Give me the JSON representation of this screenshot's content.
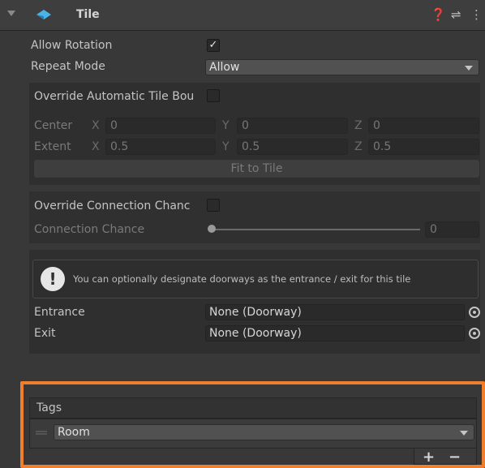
{
  "component": {
    "title": "Tile"
  },
  "fields": {
    "allow_rotation": {
      "label": "Allow Rotation",
      "checked": true
    },
    "repeat_mode": {
      "label": "Repeat Mode",
      "value": "Allow"
    },
    "override_bounds": {
      "label": "Override Automatic Tile Bou",
      "checked": false
    },
    "center": {
      "label": "Center",
      "x": "0",
      "y": "0",
      "z": "0"
    },
    "extent": {
      "label": "Extent",
      "x": "0.5",
      "y": "0.5",
      "z": "0.5"
    },
    "fit_to_tile": "Fit to Tile",
    "override_connection": {
      "label": "Override Connection Chanc",
      "checked": false
    },
    "connection_chance": {
      "label": "Connection Chance",
      "value": "0"
    }
  },
  "axes": {
    "x": "X",
    "y": "Y",
    "z": "Z"
  },
  "help": {
    "text": "You can optionally designate doorways as the entrance / exit for this tile"
  },
  "entrance": {
    "label": "Entrance",
    "value": "None (Doorway)"
  },
  "exit": {
    "label": "Exit",
    "value": "None (Doorway)"
  },
  "tags": {
    "label": "Tags",
    "items": [
      "Room"
    ],
    "add": "+",
    "remove": "−"
  },
  "glyphs": {
    "check": "✓",
    "help": "❓",
    "settings": "⇌",
    "more": "⋮",
    "warn": "!"
  },
  "colors": {
    "highlight": "#f07f2d",
    "tile_icon": "#4ab3e8"
  }
}
